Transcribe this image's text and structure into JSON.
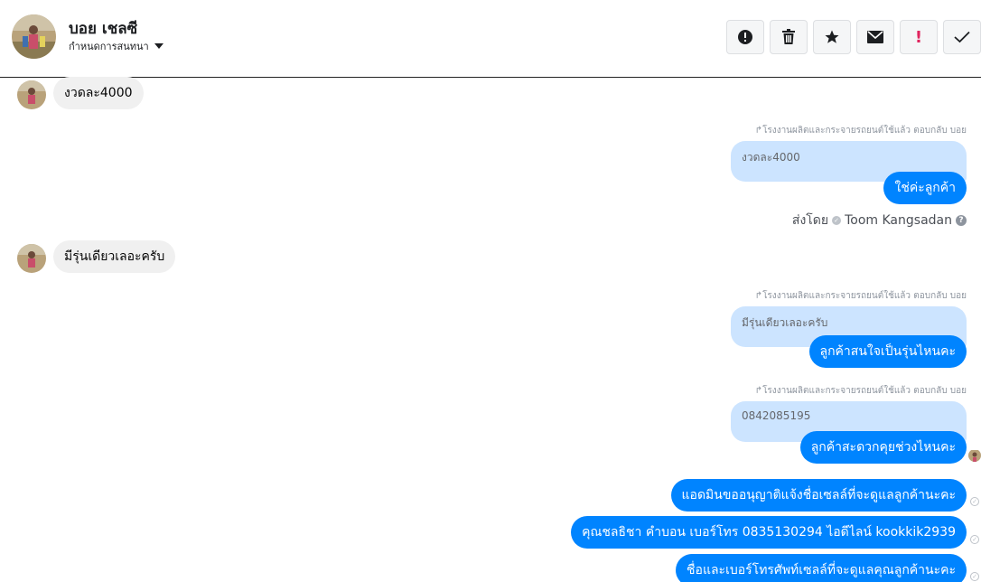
{
  "header": {
    "contact_name": "บอย เชลซี",
    "assign_label": "กำหนดการสนทนา",
    "actions": [
      {
        "icon": "alert-circle-icon",
        "glyph": "!"
      },
      {
        "icon": "trash-icon",
        "glyph": "🗑"
      },
      {
        "icon": "star-icon",
        "glyph": "★"
      },
      {
        "icon": "envelope-icon",
        "glyph": "✉"
      },
      {
        "icon": "exclamation-icon",
        "glyph": "!"
      },
      {
        "icon": "checkmark-icon",
        "glyph": "✓"
      }
    ]
  },
  "messages": {
    "in1": "งวดละ4000",
    "reply_note_1": "โรงงานผลิตและกระจายรถยนต์ใช้แล้ว ตอบกลับ บอย",
    "quote_1": "งวดละ4000",
    "out1": "ใช่ค่ะลูกค้า",
    "sent_by_prefix": "ส่งโดย",
    "sent_by_agent": "Toom Kangsadan",
    "in2": "มีรุ่นเดียวเลอะครับ",
    "reply_note_2": "โรงงานผลิตและกระจายรถยนต์ใช้แล้ว ตอบกลับ บอย",
    "quote_2": "มีรุ่นเดียวเลอะครับ",
    "out2": "ลูกค้าสนใจเป็นรุ่นไหนคะ",
    "reply_note_3": "โรงงานผลิตและกระจายรถยนต์ใช้แล้ว ตอบกลับ บอย",
    "quote_3": "0842085195",
    "out3": "ลูกค้าสะดวกคุยช่วงไหนคะ",
    "out4": "แอดมินขออนุญาติแจ้งชื่อเซลล์ที่จะดูแลลูกค้านะคะ",
    "out5": "คุณชลธิชา คำบอน เบอร์โทร 0835130294 ไอดีไลน์ kookkik2939",
    "out6": "ชื่อและเบอร์โทรศัพท์เซลล์ที่จะดูแลคุณลูกค้านะคะ"
  }
}
